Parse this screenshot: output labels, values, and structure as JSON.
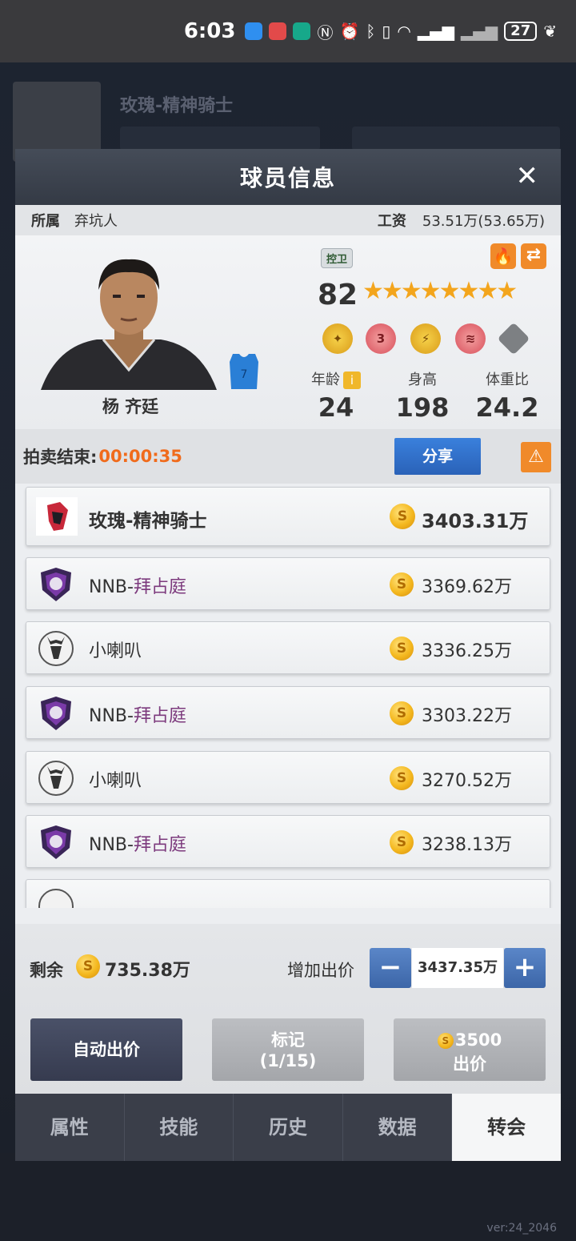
{
  "status_bar": {
    "time": "6:03",
    "battery": "27"
  },
  "background": {
    "team_name": "玫瑰-精神骑士",
    "version": "ver:24_2046"
  },
  "modal": {
    "title": "球员信息",
    "affiliation_label": "所属",
    "affiliation_value": "弃坑人",
    "salary_label": "工资",
    "salary_value": "53.51万(53.65万)"
  },
  "player": {
    "name": "杨 齐廷",
    "jersey_number": "7",
    "position": "控卫",
    "rating": "82",
    "stars": "★★★★★★★★",
    "star_count": 8,
    "age_label": "年龄",
    "age": "24",
    "height_label": "身高",
    "height": "198",
    "weight_ratio_label": "体重比",
    "weight_ratio": "24.2",
    "badges": [
      {
        "icon": "gold-medal-icon",
        "color": "#e8b52a"
      },
      {
        "icon": "number-3-medal-icon",
        "text": "3",
        "color": "#dc5c66"
      },
      {
        "icon": "lightning-medal-icon",
        "color": "#e8b52a"
      },
      {
        "icon": "wing-medal-icon",
        "color": "#dc5c66"
      },
      {
        "icon": "locked-badge-icon",
        "color": "#7d8083"
      }
    ]
  },
  "auction": {
    "end_label": "拍卖结束:",
    "timer": "00:00:35",
    "share_label": "分享"
  },
  "bids": [
    {
      "team": "玫瑰-精神骑士",
      "team_prefix": "",
      "team_accent": "",
      "amount": "3403.31万",
      "logo": "rose-knight-logo",
      "top": true
    },
    {
      "team_prefix": "NNB-",
      "team_accent": "拜占庭",
      "amount": "3369.62万",
      "logo": "byzantine-logo"
    },
    {
      "team_prefix": "小喇叭",
      "team_accent": "",
      "amount": "3336.25万",
      "logo": "stag-logo"
    },
    {
      "team_prefix": "NNB-",
      "team_accent": "拜占庭",
      "amount": "3303.22万",
      "logo": "byzantine-logo"
    },
    {
      "team_prefix": "小喇叭",
      "team_accent": "",
      "amount": "3270.52万",
      "logo": "stag-logo"
    },
    {
      "team_prefix": "NNB-",
      "team_accent": "拜占庭",
      "amount": "3238.13万",
      "logo": "byzantine-logo"
    }
  ],
  "controls": {
    "remaining_label": "剩余",
    "remaining_value": "735.38万",
    "raise_label": "增加出价",
    "raise_value": "3437.35万",
    "minus": "−",
    "plus": "+",
    "auto_bid": "自动出价",
    "mark_line1": "标记",
    "mark_line2": "(1/15)",
    "bid_amount": "3500",
    "bid_label": "出价"
  },
  "tabs": [
    {
      "label": "属性",
      "active": false
    },
    {
      "label": "技能",
      "active": false
    },
    {
      "label": "历史",
      "active": false
    },
    {
      "label": "数据",
      "active": false
    },
    {
      "label": "转会",
      "active": true
    }
  ]
}
